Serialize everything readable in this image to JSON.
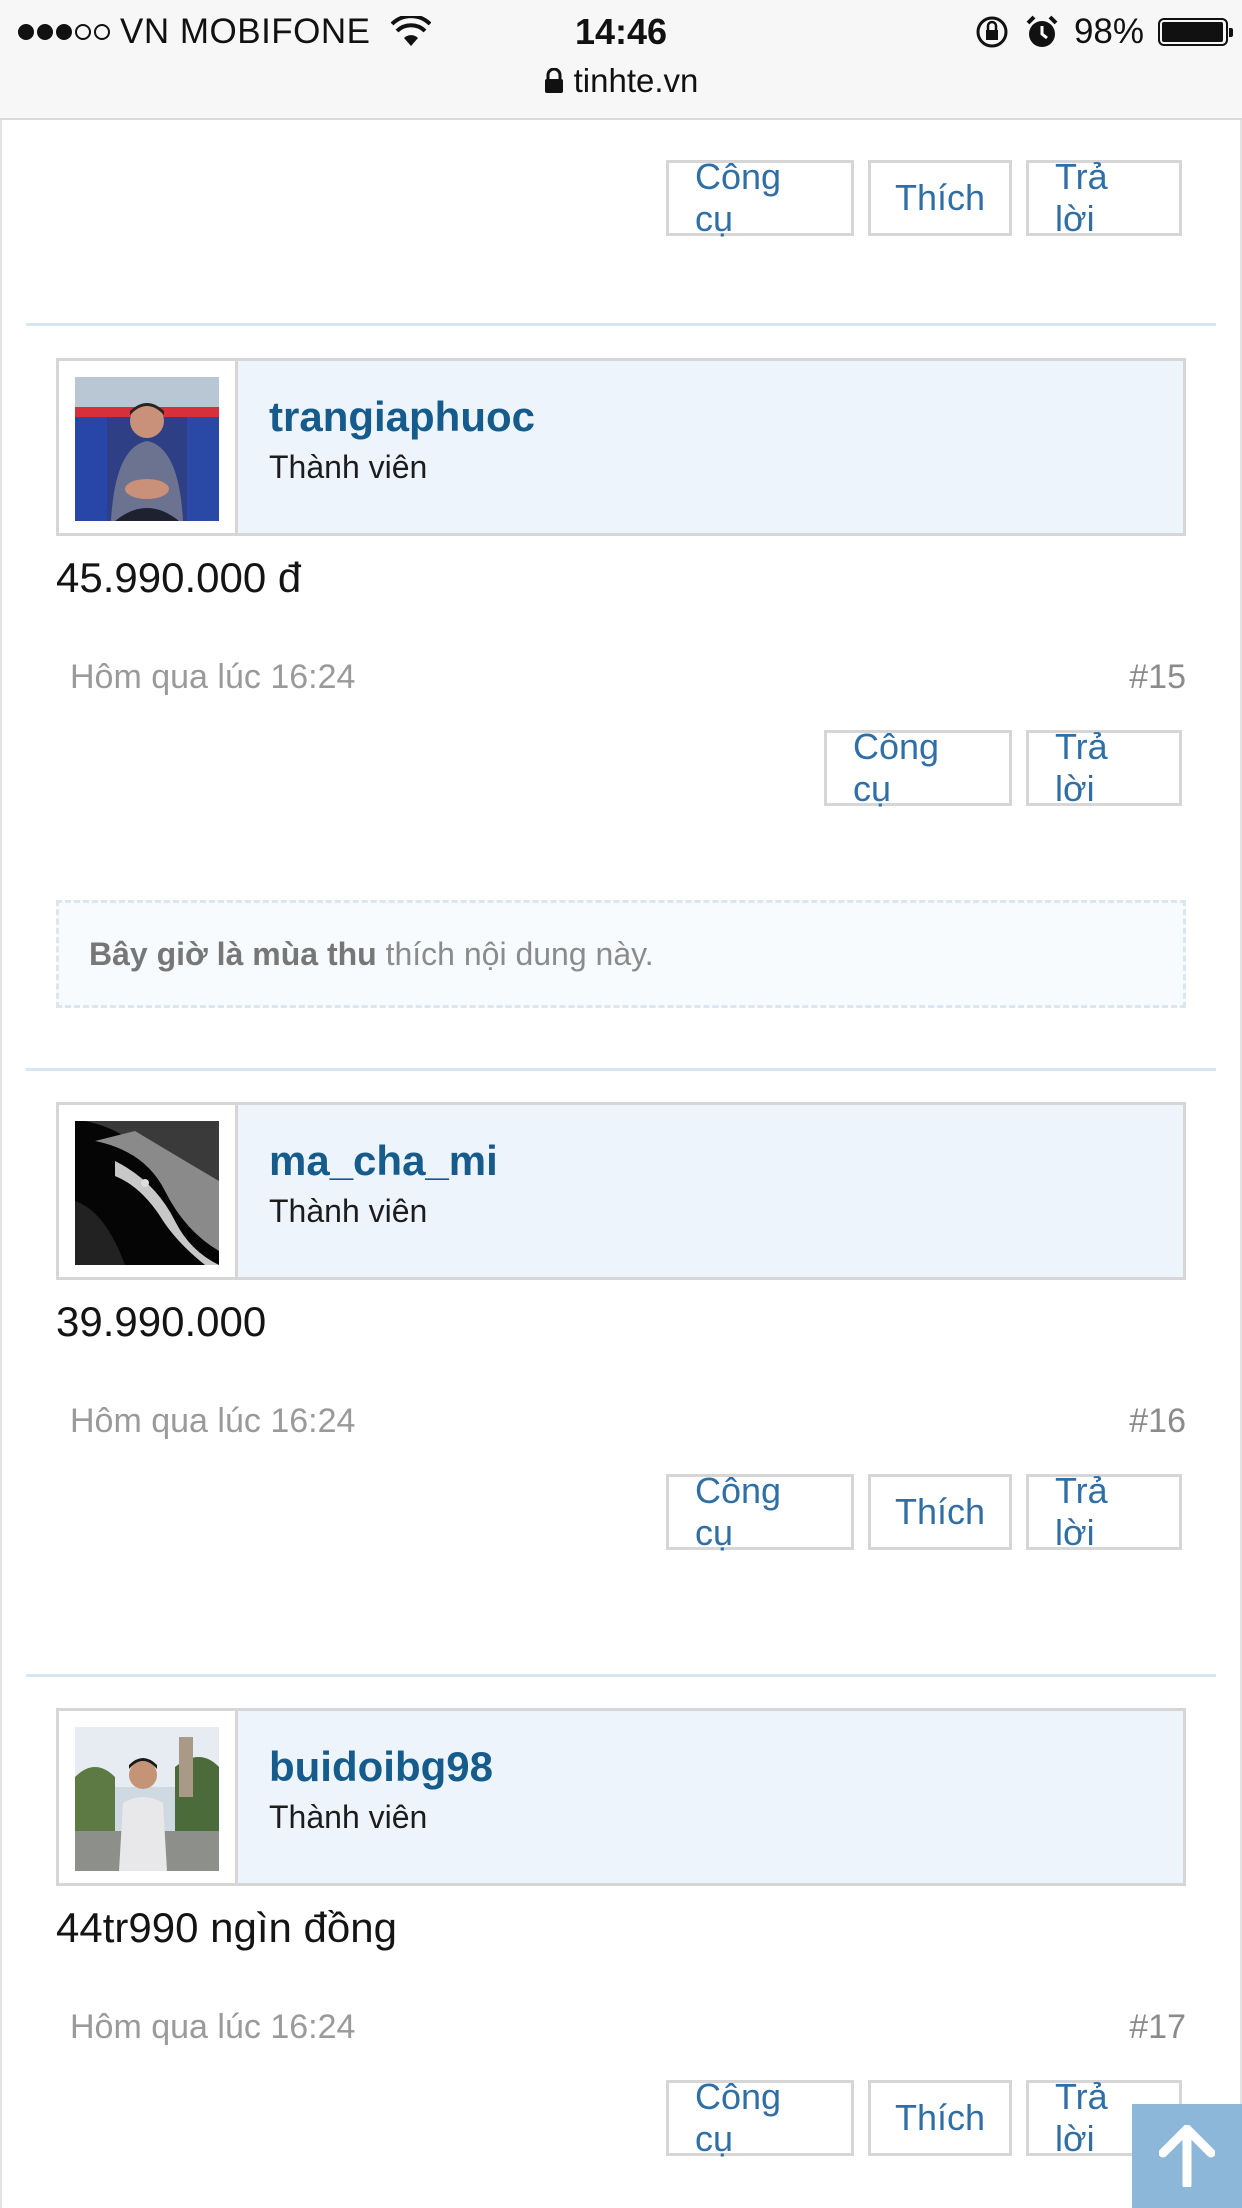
{
  "status": {
    "carrier": "VN MOBIFONE",
    "time": "14:46",
    "battery": "98%",
    "battery_level": 0.98,
    "url": "tinhte.vn"
  },
  "buttons": {
    "tools": "Công cụ",
    "like": "Thích",
    "reply": "Trả lời"
  },
  "posts": [
    {
      "username": "trangiaphuoc",
      "role": "Thành viên",
      "message": "45.990.000 đ",
      "date": "Hôm qua lúc 16:24",
      "number": "#15",
      "likes": {
        "user": "Bây giờ là mùa thu",
        "text": " thích nội dung này."
      }
    },
    {
      "username": "ma_cha_mi",
      "role": "Thành viên",
      "message": "39.990.000",
      "date": "Hôm qua lúc 16:24",
      "number": "#16"
    },
    {
      "username": "buidoibg98",
      "role": "Thành viên",
      "message": "44tr990 ngìn đồng",
      "date": "Hôm qua lúc 16:24",
      "number": "#17"
    }
  ],
  "icons": {
    "lock": "lock-icon",
    "wifi": "wifi-icon",
    "alarm": "alarm-icon",
    "rotation_lock": "rotation-lock-icon",
    "scroll_top": "arrow-up-icon"
  }
}
